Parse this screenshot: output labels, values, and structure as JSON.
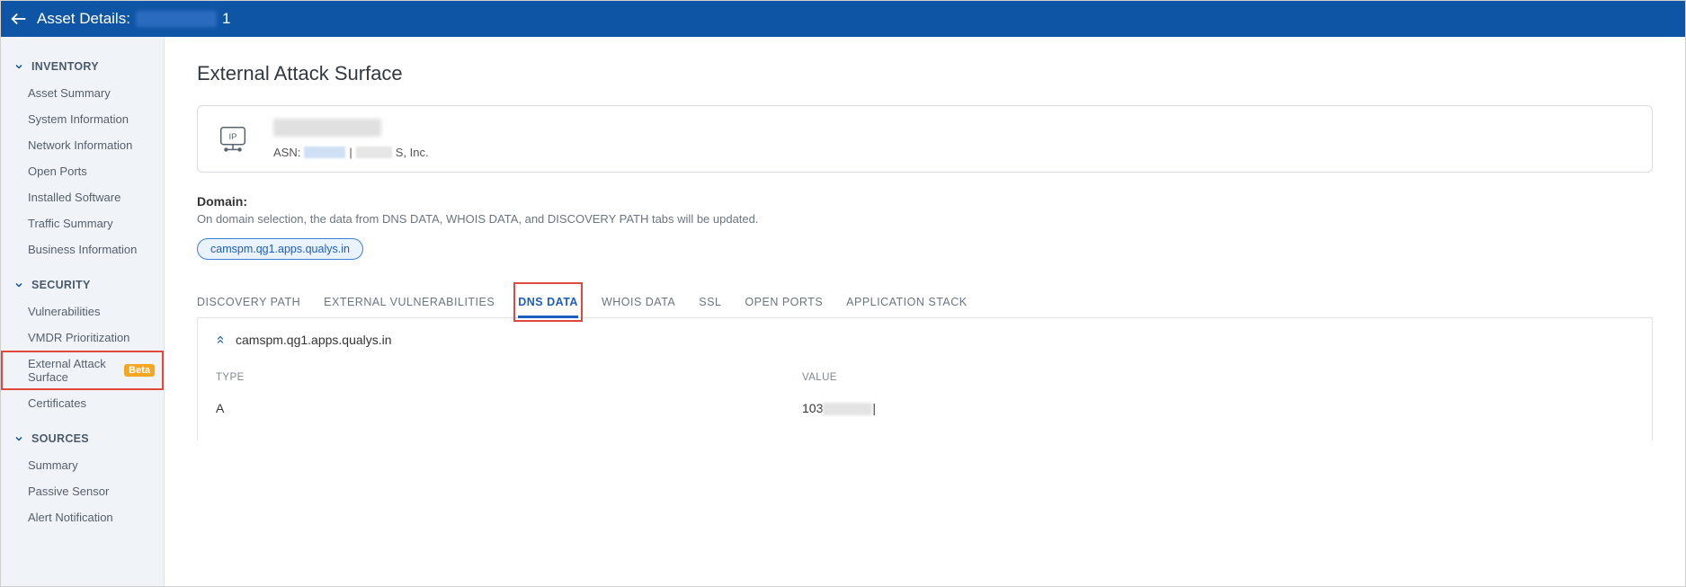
{
  "header": {
    "title_prefix": "Asset Details:",
    "asset_suffix": "1"
  },
  "sidebar": {
    "groups": [
      {
        "label": "INVENTORY",
        "items": [
          "Asset Summary",
          "System Information",
          "Network Information",
          "Open Ports",
          "Installed Software",
          "Traffic Summary",
          "Business Information"
        ]
      },
      {
        "label": "SECURITY",
        "items": [
          "Vulnerabilities",
          "VMDR Prioritization",
          "External Attack Surface",
          "Certificates"
        ],
        "beta_on": "External Attack Surface",
        "active": "External Attack Surface"
      },
      {
        "label": "SOURCES",
        "items": [
          "Summary",
          "Passive Sensor",
          "Alert Notification"
        ]
      }
    ],
    "beta_label": "Beta"
  },
  "page": {
    "title": "External Attack Surface",
    "asn_label": "ASN:",
    "divider": "|",
    "org_suffix": "S, Inc.",
    "domain_label": "Domain:",
    "domain_desc": "On domain selection, the data from DNS DATA, WHOIS DATA, and DISCOVERY PATH tabs will be updated.",
    "domain_chip": "camspm.qg1.apps.qualys.in",
    "tabs": [
      "DISCOVERY PATH",
      "EXTERNAL VULNERABILITIES",
      "DNS DATA",
      "WHOIS DATA",
      "SSL",
      "OPEN PORTS",
      "APPLICATION STACK"
    ],
    "active_tab": "DNS DATA",
    "dns": {
      "expander": "camspm.qg1.apps.qualys.in",
      "columns": {
        "type": "TYPE",
        "value": "VALUE"
      },
      "rows": [
        {
          "type": "A",
          "value_prefix": "103",
          "value_suffix": "|"
        }
      ]
    }
  }
}
